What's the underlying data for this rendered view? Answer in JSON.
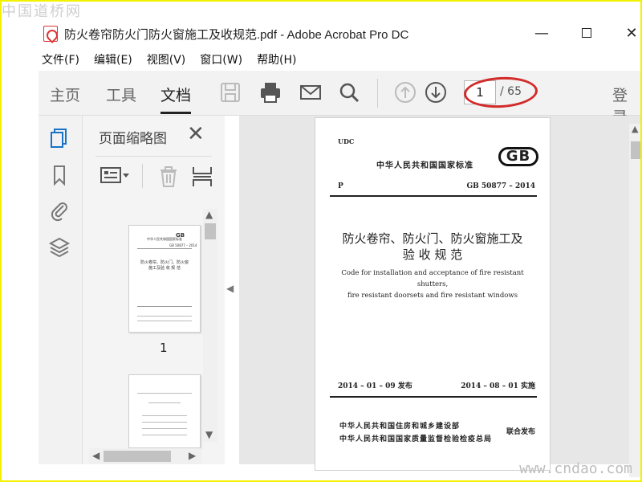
{
  "watermarks": {
    "top": "中国道桥网",
    "bottom": "www.cndao.com"
  },
  "window": {
    "title": "防火卷帘防火门防火窗施工及收规范.pdf - Adobe Acrobat Pro DC",
    "minimize": "—",
    "close": "✕"
  },
  "menu": [
    "文件(F)",
    "编辑(E)",
    "视图(V)",
    "窗口(W)",
    "帮助(H)"
  ],
  "toolbar": {
    "tabs": [
      "主页",
      "工具",
      "文档"
    ],
    "active_tab": "文档",
    "page_current": "1",
    "page_total": "/ 65",
    "login": "登录",
    "icons": [
      "save-icon",
      "print-icon",
      "mail-icon",
      "search-icon",
      "arrow-up-icon",
      "arrow-down-icon"
    ]
  },
  "left_rail": {
    "icons": [
      "page-thumbnails-icon",
      "bookmark-icon",
      "attachment-icon",
      "layers-icon"
    ]
  },
  "thumbnails": {
    "title": "页面缩略图",
    "close": "✕",
    "page_label": "1",
    "mini_page1": {
      "header": "中华人民共和国国家标准",
      "gb": "GB",
      "code": "GB 50877 – 2014",
      "title": "防火卷帘、防火门、防火窗施工及验 收 规 范"
    }
  },
  "document": {
    "udc": "UDC",
    "national_standard": "中华人民共和国国家标准",
    "gb_logo": "GB",
    "class_p": "P",
    "code": "GB 50877 – 2014",
    "title_cn_line1": "防火卷帘、防火门、防火窗施工及",
    "title_cn_line2": "验 收 规 范",
    "title_en_line1": "Code for installation and acceptance of fire resistant shutters,",
    "title_en_line2": "fire resistant doorsets and fire resistant windows",
    "issue_date": "2014 – 01 – 09  发布",
    "implement_date": "2014 – 08 – 01  实施",
    "issuer1": "中华人民共和国住房和城乡建设部",
    "issuer2": "中华人民共和国国家质量监督检验检疫总局",
    "joint_issue": "联合发布"
  },
  "colors": {
    "outer_border": "#f4f100",
    "annotation_ellipse": "#d32a2a",
    "toolbar_bg": "#f2f2f2"
  }
}
